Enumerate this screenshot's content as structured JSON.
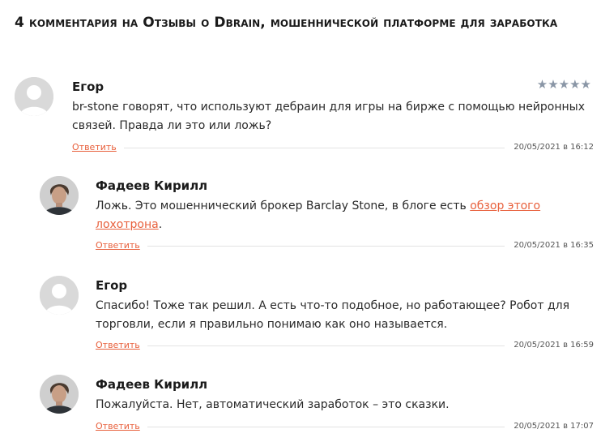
{
  "heading": "4 комментария на Отзывы о Dbrain, мошеннической платформе для заработка",
  "colors": {
    "link": "#e8603c",
    "stars": "#8a96a6"
  },
  "comments": [
    {
      "author": "Егор",
      "rating": "★★★★★",
      "text": "br-stone говорят, что используют дебраин для игры на бирже с помощью нейронных связей. Правда ли это или ложь?",
      "reply": "Ответить",
      "date": "20/05/2021 в 16:12",
      "avatar": "default-avatar-icon"
    },
    {
      "author": "Фадеев Кирилл",
      "text_before": "Ложь. Это мошеннический брокер Barclay Stone, в блоге есть ",
      "link_text": "обзор этого лохотрона",
      "text_after": ".",
      "reply": "Ответить",
      "date": "20/05/2021 в 16:35",
      "avatar": "user-photo"
    },
    {
      "author": "Егор",
      "text": "Спасибо! Тоже так решил. А есть что-то подобное, но работающее? Робот для торговли, если я правильно понимаю как оно называется.",
      "reply": "Ответить",
      "date": "20/05/2021 в 16:59",
      "avatar": "default-avatar-icon"
    },
    {
      "author": "Фадеев Кирилл",
      "text": "Пожалуйста. Нет, автоматический заработок – это сказки.",
      "reply": "Ответить",
      "date": "20/05/2021 в 17:07",
      "avatar": "user-photo"
    }
  ]
}
